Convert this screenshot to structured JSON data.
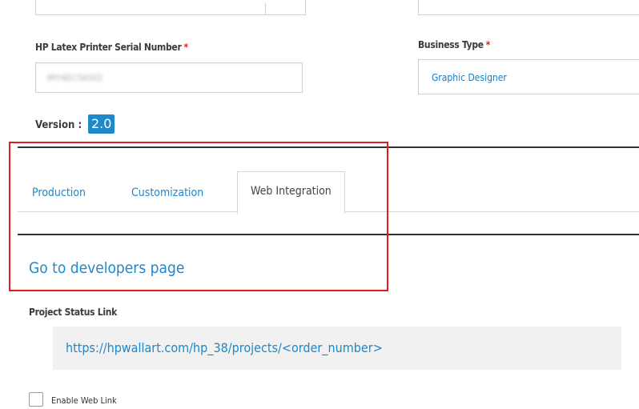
{
  "form": {
    "serial_label": "HP Latex Printer Serial Number",
    "serial_required": "*",
    "serial_value": "MY4EC5K0I2",
    "business_label": "Business Type",
    "business_required": "*",
    "business_value": "Graphic Designer",
    "version_label": "Version :",
    "version_value": "2.0"
  },
  "tabs": [
    {
      "label": "Production"
    },
    {
      "label": "Customization"
    },
    {
      "label": "Web Integration"
    }
  ],
  "active_tab": "Web Integration",
  "developers_link": "Go to developers page",
  "project_status": {
    "label": "Project Status Link",
    "url": "https://hpwallart.com/hp_38/projects/<order_number>"
  },
  "enable_web_link": {
    "label": "Enable Web Link",
    "checked": false
  },
  "colors": {
    "accent": "#1f87c8",
    "required": "#e2231a",
    "highlight_box": "#e31b23",
    "version_badge": "#1e88c9"
  }
}
